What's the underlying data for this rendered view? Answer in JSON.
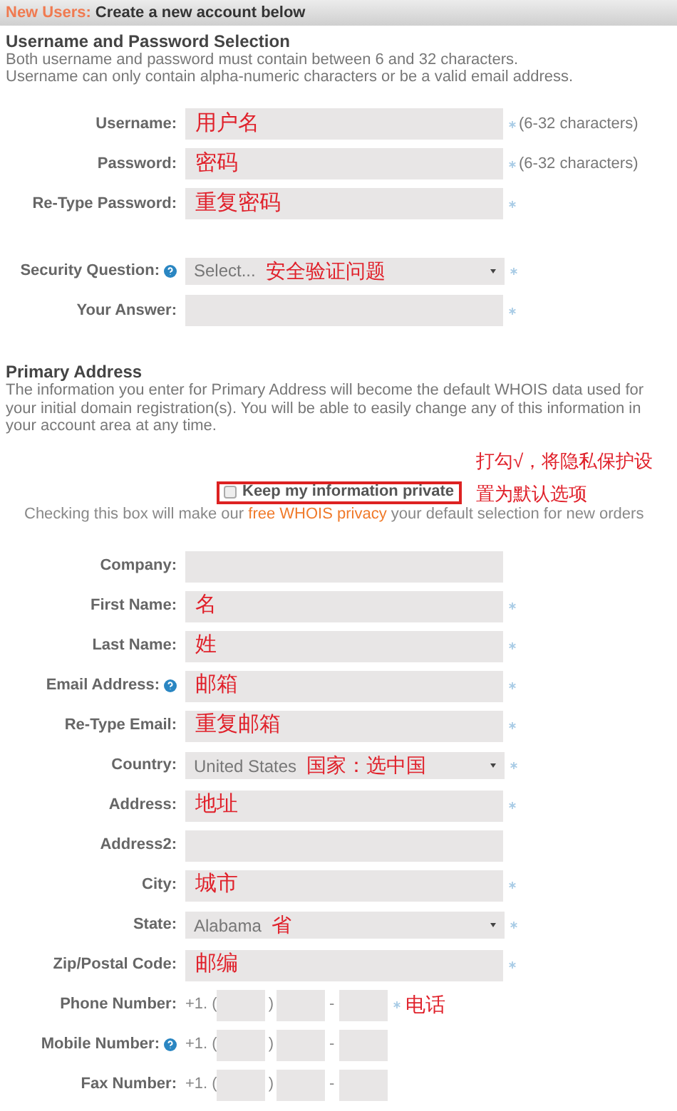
{
  "header": {
    "prefix": "New Users:",
    "title": "Create a new account below"
  },
  "account": {
    "heading": "Username and Password Selection",
    "lines": [
      "Both username and password must contain between 6 and 32 characters.",
      "Username can only contain alpha-numeric characters or be a valid email address."
    ],
    "fields": [
      {
        "kind": "text",
        "label": "Username:",
        "value": "用户名",
        "required": true,
        "hint": "(6-32 characters)"
      },
      {
        "kind": "text",
        "label": "Password:",
        "value": "密码",
        "required": true,
        "hint": "(6-32 characters)"
      },
      {
        "kind": "text",
        "label": "Re-Type Password:",
        "value": "重复密码",
        "required": true
      }
    ],
    "security": [
      {
        "kind": "select",
        "label": "Security Question:",
        "help": true,
        "value": "Select...",
        "note": "安全验证问题",
        "required": true
      },
      {
        "kind": "text",
        "label": "Your Answer:",
        "required": true
      }
    ]
  },
  "address": {
    "heading": "Primary Address",
    "text": "The information you enter for Primary Address will become the default WHOIS data used for your initial domain registration(s). You will be able to easily change any of this information in your account area at any time.",
    "privacy": {
      "label": "Keep my information private",
      "checked": false,
      "annotation": [
        "打勾√，将隐私保护设",
        "置为默认选项"
      ],
      "note_before": "Checking this box will make our",
      "link": "free WHOIS privacy",
      "note_after": "your default selection for new orders"
    },
    "fields": [
      {
        "kind": "text",
        "label": "Company:",
        "required": false
      },
      {
        "kind": "text",
        "label": "First Name:",
        "value": "名",
        "required": true
      },
      {
        "kind": "text",
        "label": "Last Name:",
        "value": "姓",
        "required": true
      },
      {
        "kind": "text",
        "label": "Email Address:",
        "help": true,
        "value": "邮箱",
        "required": true
      },
      {
        "kind": "text",
        "label": "Re-Type Email:",
        "value": "重复邮箱",
        "required": true
      },
      {
        "kind": "select",
        "label": "Country:",
        "value": "United States",
        "note": "国家：选中国",
        "required": true
      },
      {
        "kind": "text",
        "label": "Address:",
        "value": "地址",
        "required": true
      },
      {
        "kind": "text",
        "label": "Address2:",
        "required": false
      },
      {
        "kind": "text",
        "label": "City:",
        "value": "城市",
        "required": true
      },
      {
        "kind": "select",
        "label": "State:",
        "value": "Alabama",
        "note": "省",
        "required": true
      },
      {
        "kind": "text",
        "label": "Zip/Postal Code:",
        "value": "邮编",
        "required": true
      },
      {
        "kind": "phone",
        "label": "Phone Number:",
        "parts": [
          "+1. (",
          ")",
          "-"
        ],
        "required": true,
        "note": "电话"
      },
      {
        "kind": "phone",
        "label": "Mobile Number:",
        "help": true,
        "parts": [
          "+1. (",
          ")",
          "-"
        ],
        "required": false
      },
      {
        "kind": "phone",
        "label": "Fax Number:",
        "parts": [
          "+1. (",
          ")",
          "-"
        ],
        "required": false
      }
    ]
  }
}
